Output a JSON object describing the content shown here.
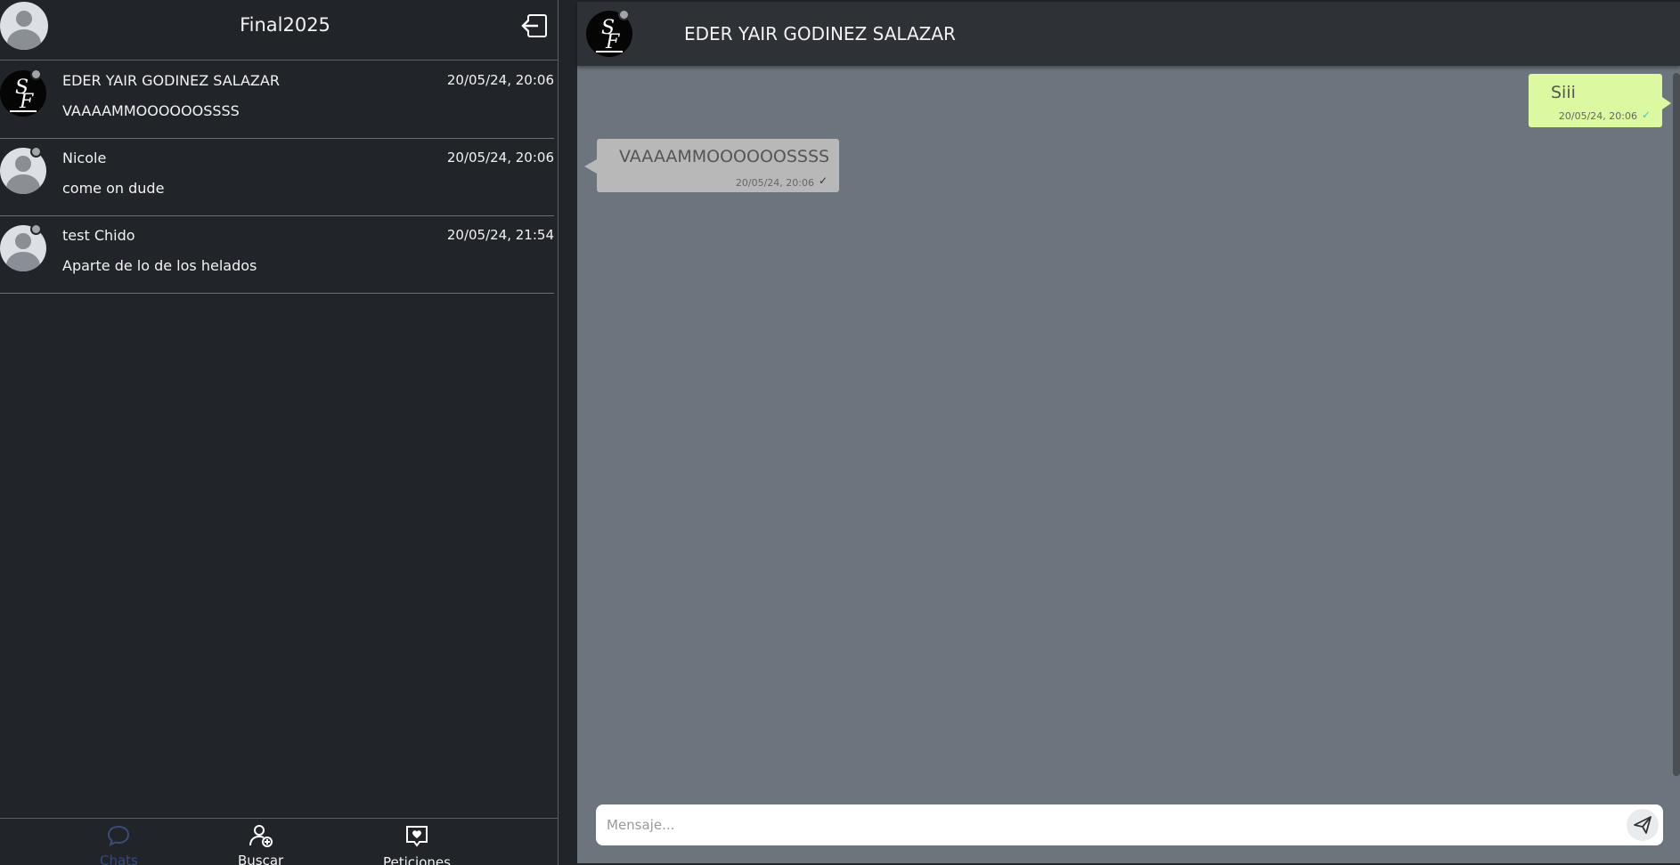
{
  "sidebar": {
    "title": "Final2025",
    "chats": [
      {
        "name": "EDER YAIR GODINEZ SALAZAR",
        "time": "20/05/24, 20:06",
        "preview": "VAAAAMMOOOOOOSSSS",
        "avatar": "sf-logo"
      },
      {
        "name": "Nicole",
        "time": "20/05/24, 20:06",
        "preview": "come on dude",
        "avatar": "generic-user"
      },
      {
        "name": "test Chido",
        "time": "20/05/24, 21:54",
        "preview": "Aparte de lo de los helados",
        "avatar": "generic-user"
      }
    ],
    "nav": {
      "chats": "Chats",
      "buscar": "Buscar",
      "peticiones": "Peticiones"
    }
  },
  "conversation": {
    "title": "EDER YAIR GODINEZ SALAZAR",
    "messages": [
      {
        "direction": "out",
        "text": "Siii",
        "time": "20/05/24, 20:06"
      },
      {
        "direction": "in",
        "text": "VAAAAMMOOOOOOSSSS",
        "time": "20/05/24, 20:06"
      }
    ],
    "composer": {
      "placeholder": "Mensaje..."
    }
  },
  "colors": {
    "sidebar_bg": "#212529",
    "conversation_bg": "#6c757d",
    "header_bg": "#2e3135",
    "outgoing_bubble": "#dcf8a0",
    "incoming_bubble": "#b8b8b8",
    "read_check": "#43c7c2"
  }
}
